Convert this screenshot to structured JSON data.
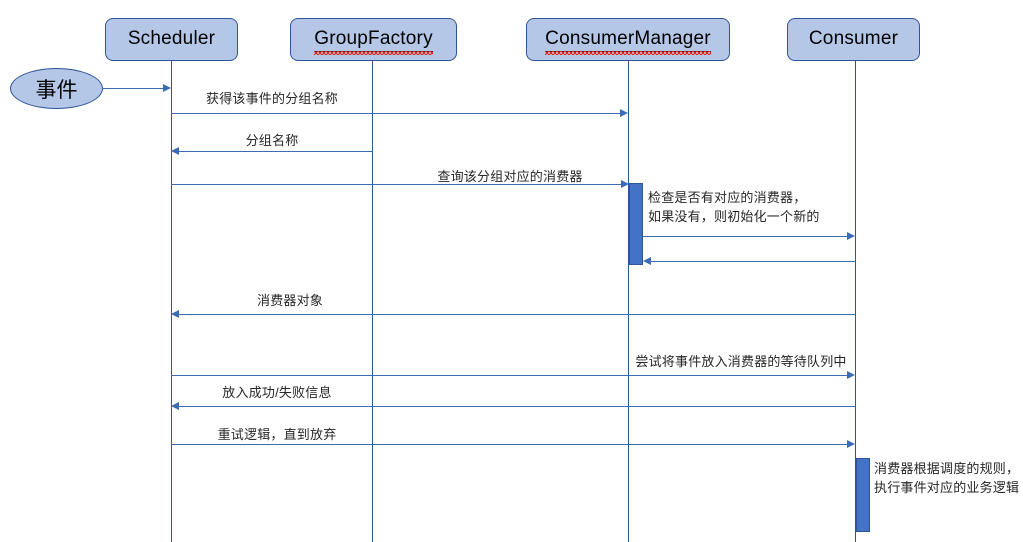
{
  "diagram": {
    "type": "sequence-diagram",
    "background_color": "#ffffff",
    "accent_color": "#4472c4",
    "box_fill_color": "#b4c7e7",
    "box_border_color": "#2e5597",
    "line_color": "#3b6cb5",
    "spellcheck_underline_color": "#e8271a"
  },
  "actor": {
    "label": "事件"
  },
  "participants": [
    {
      "name": "Scheduler",
      "label": "Scheduler",
      "misspelled": false
    },
    {
      "name": "GroupFactory",
      "label": "GroupFactory",
      "misspelled": true
    },
    {
      "name": "ConsumerManager",
      "label": "ConsumerManager",
      "misspelled": true
    },
    {
      "name": "Consumer",
      "label": "Consumer",
      "misspelled": false
    }
  ],
  "messages": [
    {
      "label": "",
      "from": "事件",
      "to": "Scheduler",
      "direction": "right"
    },
    {
      "label": "获得该事件的分组名称",
      "from": "Scheduler",
      "to": "GroupFactory",
      "direction": "right"
    },
    {
      "label": "分组名称",
      "from": "GroupFactory",
      "to": "Scheduler",
      "direction": "left"
    },
    {
      "label": "查询该分组对应的消费器",
      "from": "Scheduler",
      "to": "ConsumerManager",
      "direction": "right"
    },
    {
      "label": "",
      "from": "ConsumerManager",
      "to": "Consumer",
      "direction": "right"
    },
    {
      "label": "",
      "from": "Consumer",
      "to": "ConsumerManager",
      "direction": "left"
    },
    {
      "label": "消费器对象",
      "from": "Consumer",
      "to": "Scheduler",
      "direction": "left"
    },
    {
      "label": "尝试将事件放入消费器的等待队列中",
      "from": "Scheduler",
      "to": "Consumer",
      "direction": "right"
    },
    {
      "label": "放入成功/失败信息",
      "from": "Consumer",
      "to": "Scheduler",
      "direction": "left"
    },
    {
      "label": "重试逻辑，直到放弃",
      "from": "Scheduler",
      "to": "Consumer",
      "direction": "right"
    }
  ],
  "notes": [
    {
      "on": "ConsumerManager",
      "line1": "检查是否有对应的消费器，",
      "line2": "如果没有，则初始化一个新的"
    },
    {
      "on": "Consumer",
      "line1": "消费器根据调度的规则，",
      "line2": "执行事件对应的业务逻辑"
    }
  ]
}
